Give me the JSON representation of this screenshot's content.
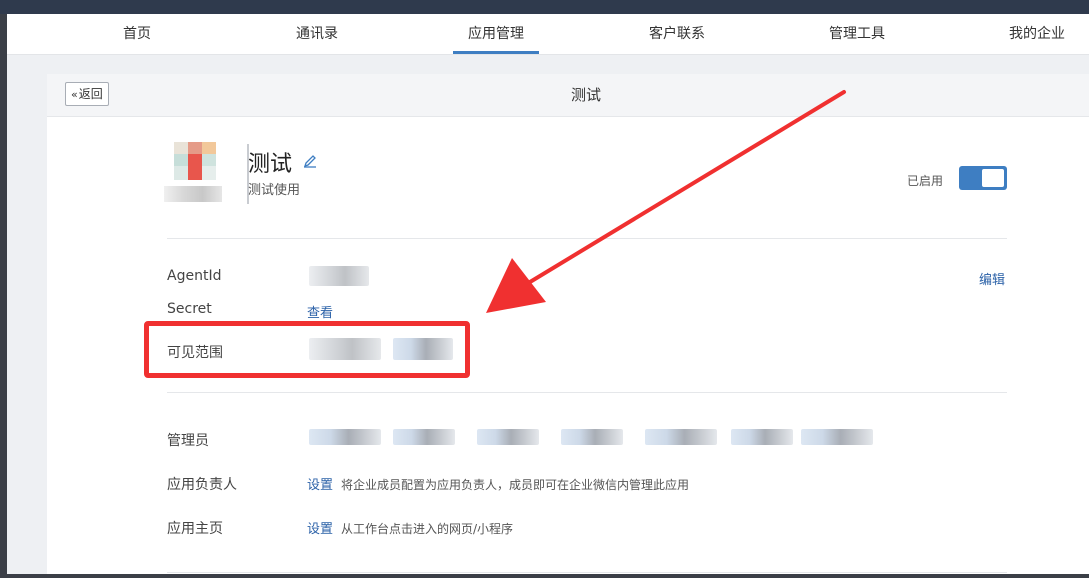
{
  "nav": {
    "items": [
      {
        "label": "首页"
      },
      {
        "label": "通讯录"
      },
      {
        "label": "应用管理",
        "active": true
      },
      {
        "label": "客户联系"
      },
      {
        "label": "管理工具"
      },
      {
        "label": "我的企业"
      }
    ],
    "accent_color": "#3e7ec2"
  },
  "header": {
    "back_label": "返回",
    "title": "测试"
  },
  "app": {
    "name": "测试",
    "description": "测试使用",
    "status_label": "已启用",
    "enabled": true
  },
  "details": {
    "agentid_label": "AgentId",
    "secret_label": "Secret",
    "secret_link": "查看",
    "visible_label": "可见范围",
    "edit_link": "编辑"
  },
  "settings": {
    "admin_label": "管理员",
    "owner_label": "应用负责人",
    "owner_link": "设置",
    "owner_hint": "将企业成员配置为应用负责人，成员即可在企业微信内管理此应用",
    "homepage_label": "应用主页",
    "homepage_link": "设置",
    "homepage_hint": "从工作台点击进入的网页/小程序"
  },
  "annotation": {
    "color": "#f03030"
  }
}
